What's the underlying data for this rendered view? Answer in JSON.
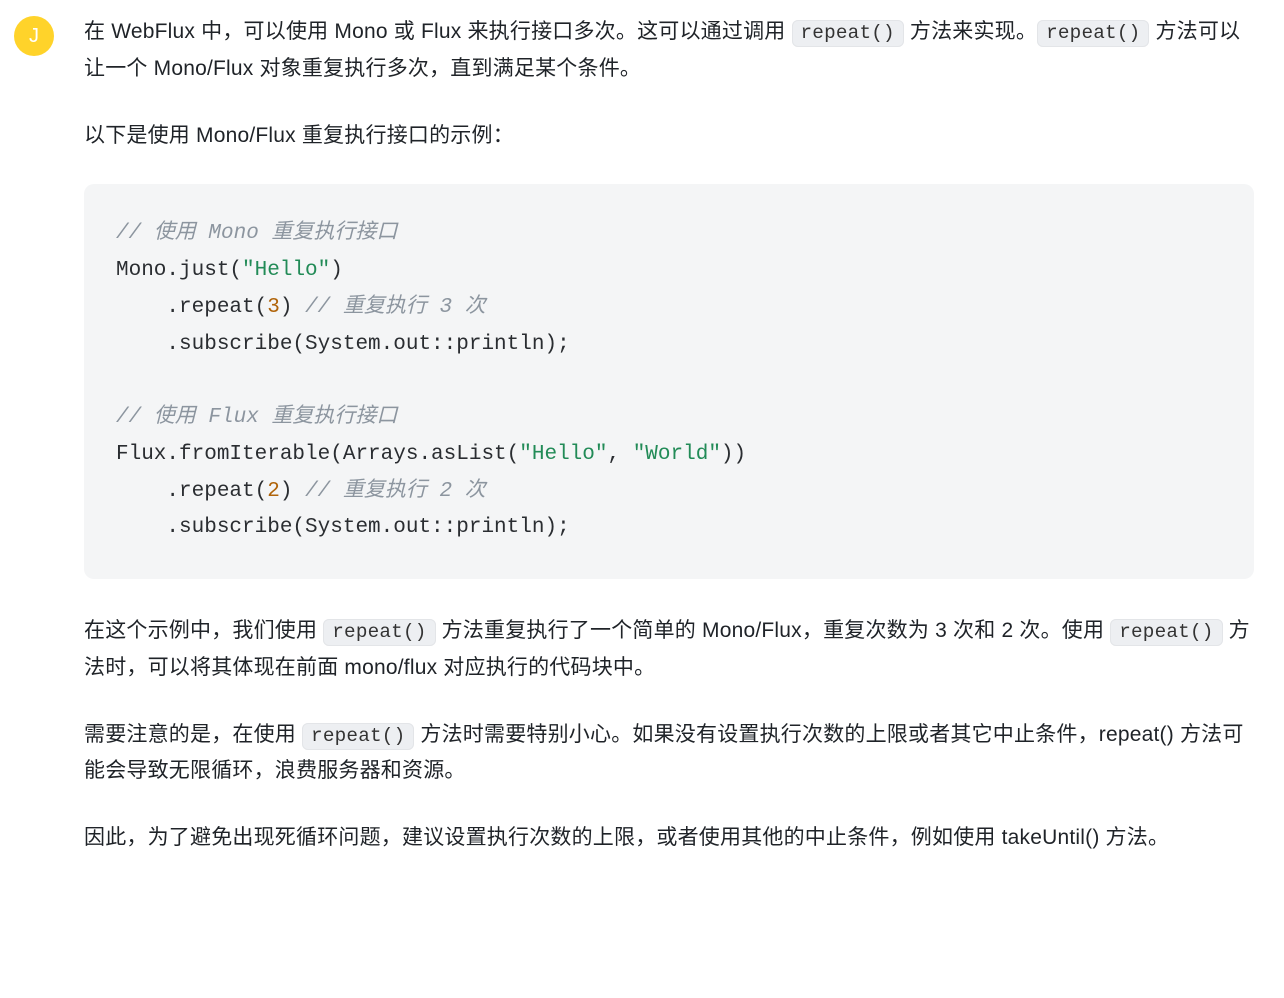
{
  "avatar_letter": "J",
  "paragraphs": {
    "intro_a": "在 WebFlux 中，可以使用 Mono 或 Flux 来执行接口多次。这可以通过调用 ",
    "intro_code1": "repeat()",
    "intro_b": " 方法来实现。",
    "intro_code2": "repeat()",
    "intro_c": " 方法可以让一个 Mono/Flux 对象重复执行多次，直到满足某个条件。",
    "example_lead": "以下是使用 Mono/Flux 重复执行接口的示例：",
    "after1_a": "在这个示例中，我们使用 ",
    "after1_code1": "repeat()",
    "after1_b": " 方法重复执行了一个简单的 Mono/Flux，重复次数为 3 次和 2 次。使用 ",
    "after1_code2": "repeat()",
    "after1_c": " 方法时，可以将其体现在前面 mono/flux 对应执行的代码块中。",
    "warn_a": "需要注意的是，在使用 ",
    "warn_code": "repeat()",
    "warn_b": " 方法时需要特别小心。如果没有设置执行次数的上限或者其它中止条件，repeat() 方法可能会导致无限循环，浪费服务器和资源。",
    "conclude": "因此，为了避免出现死循环问题，建议设置执行次数的上限，或者使用其他的中止条件，例如使用 takeUntil() 方法。"
  },
  "code": {
    "c1": "// 使用 Mono 重复执行接口",
    "l2a": "Mono.just(",
    "l2s": "\"Hello\"",
    "l2b": ")",
    "l3a": "    .repeat(",
    "l3n": "3",
    "l3b": ") ",
    "l3c": "// 重复执行 3 次",
    "l4": "    .subscribe(System.out::println);",
    "c2": "// 使用 Flux 重复执行接口",
    "l6a": "Flux.fromIterable(Arrays.asList(",
    "l6s1": "\"Hello\"",
    "l6m": ", ",
    "l6s2": "\"World\"",
    "l6b": "))",
    "l7a": "    .repeat(",
    "l7n": "2",
    "l7b": ") ",
    "l7c": "// 重复执行 2 次",
    "l8": "    .subscribe(System.out::println);"
  }
}
